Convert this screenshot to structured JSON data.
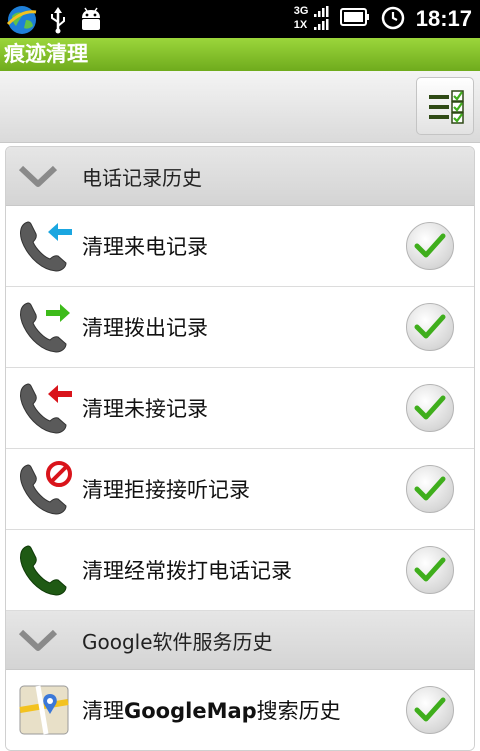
{
  "status_bar": {
    "time": "18:17",
    "network": "3G",
    "network_sub": "1X",
    "icons": [
      "globe-icon",
      "usb-icon",
      "android-debug-icon",
      "signal-icon",
      "battery-icon",
      "alarm-icon"
    ]
  },
  "app": {
    "title": "痕迹清理"
  },
  "toolbar": {
    "select_all_icon": "checklist-icon"
  },
  "sections": [
    {
      "label": "电话记录历史",
      "expanded": true,
      "items": [
        {
          "label": "清理来电记录",
          "icon": "incoming-call-icon",
          "checked": true
        },
        {
          "label": "清理拨出记录",
          "icon": "outgoing-call-icon",
          "checked": true
        },
        {
          "label": "清理未接记录",
          "icon": "missed-call-icon",
          "checked": true
        },
        {
          "label": "清理拒接接听记录",
          "icon": "rejected-call-icon",
          "checked": true
        },
        {
          "label": "清理经常拨打电话记录",
          "icon": "frequent-call-icon",
          "checked": true
        }
      ]
    },
    {
      "label": "Google软件服务历史",
      "expanded": true,
      "items": [
        {
          "label_prefix": "清理",
          "label_bold": "GoogleMap",
          "label_suffix": "搜索历史",
          "icon": "google-maps-icon",
          "checked": true
        }
      ]
    }
  ],
  "colors": {
    "title_bar": "#8cc63f",
    "check": "#3fae1c",
    "incoming_arrow": "#1aa6e0",
    "outgoing_arrow": "#3dbb1a",
    "missed_arrow": "#d9141b"
  }
}
